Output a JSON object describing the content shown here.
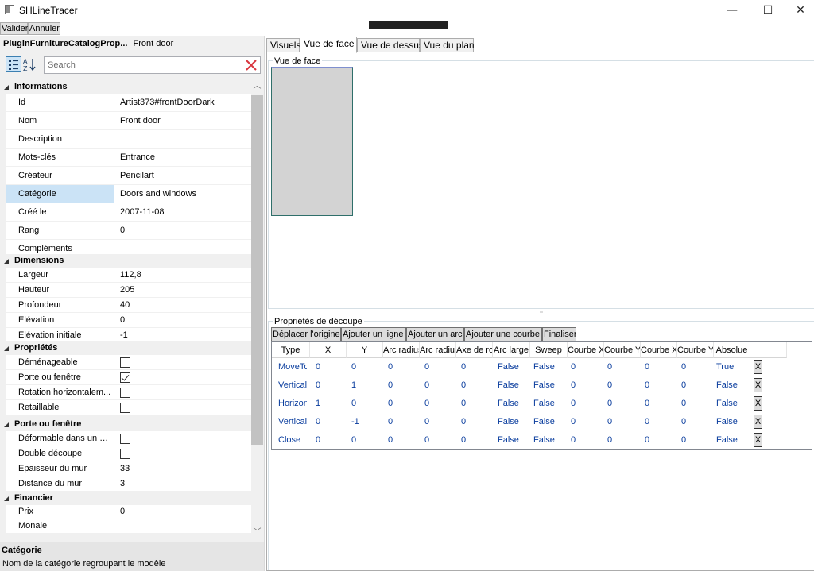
{
  "window": {
    "title": "SHLineTracer",
    "controls": {
      "minimize": "—",
      "maximize": "☐",
      "close": "✕"
    }
  },
  "toolbar": {
    "validate_label": "Valider",
    "cancel_label": "Annuler"
  },
  "inspector": {
    "object_type": "PluginFurnitureCatalogProp...",
    "object_name": "Front door",
    "search_placeholder": "Search",
    "categories": [
      {
        "name": "Informations",
        "rows": [
          {
            "name": "Id",
            "value": "Artist373#frontDoorDark"
          },
          {
            "name": "Nom",
            "value": "Front door"
          },
          {
            "name": "Description",
            "value": ""
          },
          {
            "name": "Mots-clés",
            "value": "Entrance"
          },
          {
            "name": "Créateur",
            "value": "Pencilart"
          },
          {
            "name": "Catégorie",
            "value": "Doors and windows"
          },
          {
            "name": "Créé le",
            "value": "2007-11-08"
          },
          {
            "name": "Rang",
            "value": "0"
          },
          {
            "name": "Compléments",
            "value": ""
          }
        ]
      },
      {
        "name": "Dimensions",
        "rows": [
          {
            "name": "Largeur",
            "value": "112,8"
          },
          {
            "name": "Hauteur",
            "value": "205"
          },
          {
            "name": "Profondeur",
            "value": "40"
          },
          {
            "name": "Elévation",
            "value": "0"
          },
          {
            "name": "Elévation initiale",
            "value": "-1"
          }
        ]
      },
      {
        "name": "Propriétés",
        "rows": [
          {
            "name": "Déménageable",
            "checked": false
          },
          {
            "name": "Porte ou fenêtre",
            "checked": true
          },
          {
            "name": "Rotation horizontalem...",
            "checked": false
          },
          {
            "name": "Retaillable",
            "checked": false
          }
        ]
      },
      {
        "name": "Porte ou fenêtre",
        "rows": [
          {
            "name": "Déformable dans un m...",
            "checked": false
          },
          {
            "name": "Double découpe",
            "checked": false
          },
          {
            "name": "Epaisseur du mur",
            "value": "33"
          },
          {
            "name": "Distance du mur",
            "value": "3"
          }
        ]
      },
      {
        "name": "Financier",
        "rows": [
          {
            "name": "Prix",
            "value": "0"
          },
          {
            "name": "Monaie",
            "value": ""
          }
        ]
      }
    ],
    "selected_property": "Catégorie",
    "help": {
      "title": "Catégorie",
      "description": "Nom de la catégorie regroupant le modèle"
    }
  },
  "tabs": [
    "Visuels",
    "Vue de face",
    "Vue de dessus",
    "Vue du plan"
  ],
  "active_tab": "Vue de face",
  "front_view": {
    "title": "Vue de face"
  },
  "cut_properties": {
    "title": "Propriétés de découpe",
    "buttons": [
      "Déplacer l'origine",
      "Ajouter un ligne",
      "Ajouter un arc",
      "Ajouter une courbe",
      "Finaliser"
    ],
    "columns": [
      "Type",
      "X",
      "Y",
      "Arc radius",
      "Arc radius",
      "Axe de rotation",
      "Arc large",
      "Sweep",
      "Courbe X",
      "Courbe Y",
      "Courbe X",
      "Courbe Y",
      "Absolue",
      ""
    ],
    "rows": [
      [
        "MoveTo",
        "0",
        "0",
        "0",
        "0",
        "0",
        "False",
        "False",
        "0",
        "0",
        "0",
        "0",
        "True"
      ],
      [
        "Vertical",
        "0",
        "1",
        "0",
        "0",
        "0",
        "False",
        "False",
        "0",
        "0",
        "0",
        "0",
        "False"
      ],
      [
        "Horizontal",
        "1",
        "0",
        "0",
        "0",
        "0",
        "False",
        "False",
        "0",
        "0",
        "0",
        "0",
        "False"
      ],
      [
        "Vertical",
        "0",
        "-1",
        "0",
        "0",
        "0",
        "False",
        "False",
        "0",
        "0",
        "0",
        "0",
        "False"
      ],
      [
        "Close",
        "0",
        "0",
        "0",
        "0",
        "0",
        "False",
        "False",
        "0",
        "0",
        "0",
        "0",
        "False"
      ]
    ],
    "delete_label": "X"
  }
}
